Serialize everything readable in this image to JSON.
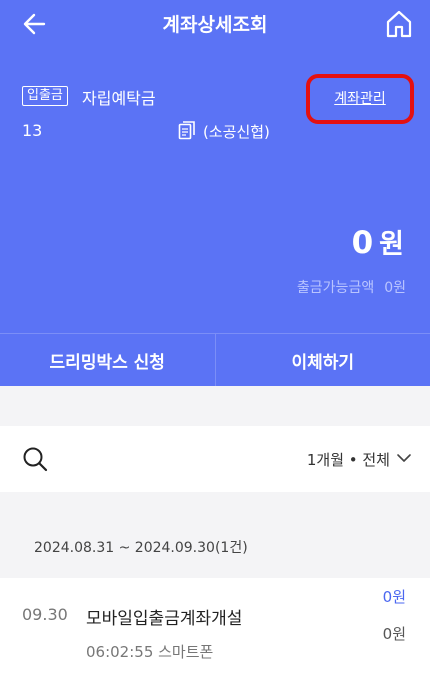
{
  "header": {
    "title": "계좌상세조회"
  },
  "account": {
    "tag": "입출금",
    "name": "자립예탁금",
    "number": "13",
    "bank": "(소공신협)",
    "manage_label": "계좌관리",
    "balance_value": "0",
    "balance_unit": "원",
    "available_label": "출금가능금액",
    "available_value": "0원"
  },
  "actions": {
    "dreaming_box": "드리밍박스 신청",
    "transfer": "이체하기"
  },
  "filter": {
    "period_label": "1개월 • 전체"
  },
  "history": {
    "range": "2024.08.31 ~ 2024.09.30(1건)",
    "items": [
      {
        "date": "09.30",
        "name": "모바일입출금계좌개설",
        "time_channel": "06:02:55 스마트폰",
        "amount": "0원",
        "balance": "0원"
      }
    ]
  },
  "colors": {
    "brand": "#5b73f5",
    "highlight": "#e41010"
  },
  "icons": {
    "back": "back-arrow-icon",
    "home": "home-icon",
    "copy": "copy-icon",
    "search": "search-icon",
    "chevron": "chevron-down-icon"
  }
}
